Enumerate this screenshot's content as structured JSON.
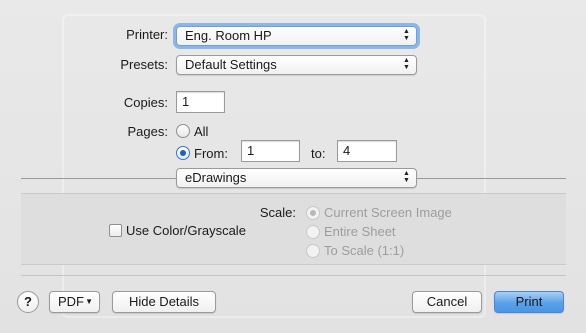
{
  "printer": {
    "label": "Printer:",
    "value": "Eng. Room HP"
  },
  "presets": {
    "label": "Presets:",
    "value": "Default Settings"
  },
  "copies": {
    "label": "Copies:",
    "value": "1"
  },
  "pages": {
    "label": "Pages:",
    "all_label": "All",
    "from_label": "From:",
    "from_value": "1",
    "to_label": "to:",
    "to_value": "4",
    "selected": "from"
  },
  "section_popup": {
    "value": "eDrawings"
  },
  "options": {
    "use_color_label": "Use Color/Grayscale",
    "use_color_checked": false,
    "scale_label": "Scale:",
    "scale_options": [
      "Current Screen Image",
      "Entire Sheet",
      "To Scale (1:1)"
    ],
    "scale_selected": "Current Screen Image",
    "scale_enabled": false
  },
  "footer": {
    "help_label": "?",
    "pdf_label": "PDF",
    "hide_details_label": "Hide Details",
    "cancel_label": "Cancel",
    "print_label": "Print"
  },
  "colors": {
    "accent": "#4a95e5",
    "focus_ring": "#5b9be8",
    "panel": "#dedede"
  }
}
